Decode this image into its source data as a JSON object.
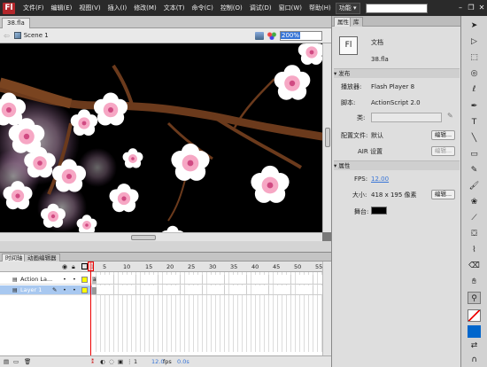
{
  "app": {
    "logo_text": "Fl",
    "search_placeholder": ""
  },
  "menu": [
    "文件(F)",
    "编辑(E)",
    "视图(V)",
    "插入(I)",
    "修改(M)",
    "文本(T)",
    "命令(C)",
    "控制(O)",
    "调试(D)",
    "窗口(W)",
    "帮助(H)"
  ],
  "workspace": {
    "label": "功能",
    "arrow": "▾"
  },
  "window_buttons": {
    "minimize": "–",
    "restore": "❐",
    "close": "✕"
  },
  "document": {
    "tab": "38.fla"
  },
  "editbar": {
    "scene": "Scene 1",
    "zoom": "200%",
    "back_arrow": "⇦"
  },
  "timeline": {
    "tabs": [
      "时间轴",
      "动画编辑器"
    ],
    "frame_numbers": [
      "1",
      "5",
      "10",
      "15",
      "20",
      "25",
      "30",
      "35",
      "40",
      "45",
      "50",
      "55"
    ],
    "layers": [
      {
        "name": "Action La...",
        "selected": false
      },
      {
        "name": "Layer 1",
        "selected": true
      }
    ],
    "current_frame": "1",
    "fps": "12.0",
    "fps_unit": "fps",
    "time": "0.0s"
  },
  "properties": {
    "tabs": [
      "属性",
      "库"
    ],
    "doc_icon": "Fl",
    "doc_type": "文档",
    "doc_name": "38.fla",
    "publish_section": "发布",
    "player_label": "播放器:",
    "player_value": "Flash Player 8",
    "script_label": "脚本:",
    "script_value": "ActionScript 2.0",
    "class_label": "类:",
    "profile_label": "配置文件:",
    "profile_value": "默认",
    "edit_button": "编辑...",
    "air_label": "AIR 设置",
    "air_button": "编辑...",
    "props_section": "属性",
    "fps_label": "FPS:",
    "fps_value": "12.00",
    "size_label": "大小:",
    "size_value": "418 x 195 像素",
    "size_button": "编辑...",
    "stage_label": "舞台:",
    "stage_color": "#000000"
  },
  "colors": {
    "accent": "#3875d7",
    "menubar": "#2a2a2a",
    "playhead": "#e00000",
    "layer_selected": "#a8c8f0"
  },
  "tools": [
    "selection-icon",
    "subselection-icon",
    "free-transform-icon",
    "3d-rotation-icon",
    "lasso-icon",
    "pen-icon",
    "text-icon",
    "line-icon",
    "rectangle-icon",
    "pencil-icon",
    "brush-icon",
    "deco-icon",
    "bone-icon",
    "paint-bucket-icon",
    "eyedropper-icon",
    "eraser-icon",
    "hand-icon",
    "zoom-icon",
    "stroke-color-icon",
    "fill-color-icon",
    "swap-colors-icon",
    "snap-icon"
  ]
}
